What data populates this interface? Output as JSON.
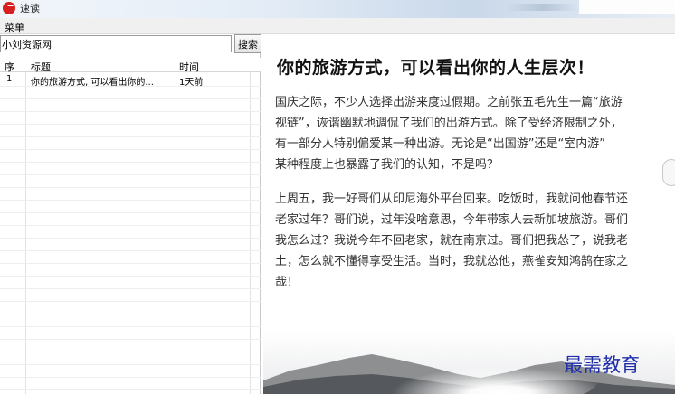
{
  "window": {
    "title": "速读"
  },
  "menu": {
    "label": "菜单"
  },
  "search": {
    "value": "小刘资源网",
    "button_label": "搜索"
  },
  "list": {
    "columns": [
      "序",
      "标题",
      "时间"
    ],
    "rows": [
      {
        "index": "1",
        "title": "你的旅游方式, 可以看出你的...",
        "time": "1天前"
      }
    ]
  },
  "article": {
    "title": "你的旅游方式，可以看出你的人生层次！",
    "paragraph1": [
      "国庆之际，不少人选择出游来度过假期。之前张五毛先生一篇“旅游",
      "视链”，诙谐幽默地调侃了我们的出游方式。除了受经济限制之外，",
      "有一部分人特别偏爱某一种出游。无论是“出国游”还是“室内游”",
      "某种程度上也暴露了我们的认知，不是吗？"
    ],
    "paragraph2": [
      "上周五，我一好哥们从印尼海外平台回来。吃饭时，我就问他春节还",
      "老家过年？哥们说，过年没啥意思，今年带家人去新加坡旅游。哥们",
      "我怎么过？我说今年不回老家，就在南京过。哥们把我怂了，说我老",
      "土，怎么就不懂得享受生活。当时，我就怂他，燕雀安知鸿鹄在家之",
      "哉！"
    ]
  },
  "watermark": "最需教育",
  "colors": {
    "app_icon": "#d81e1e",
    "watermark": "#1f2ea8"
  }
}
